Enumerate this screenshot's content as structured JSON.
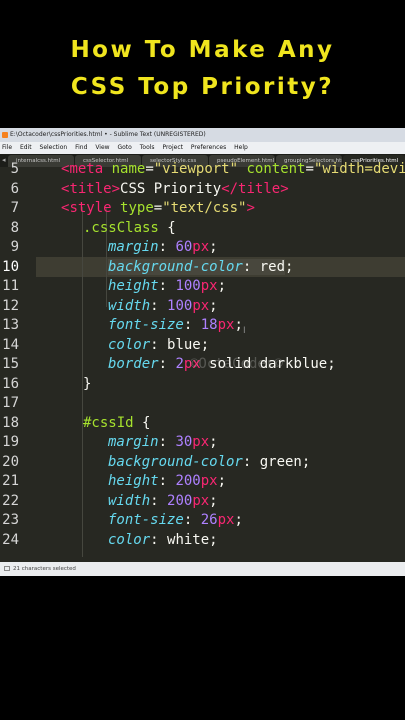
{
  "headline": {
    "line1": "How To Make Any",
    "line2": "CSS Top Priority?"
  },
  "window": {
    "title": "E:\\Octacoder\\cssPriorities.html • - Sublime Text (UNREGISTERED)",
    "menu": [
      "File",
      "Edit",
      "Selection",
      "Find",
      "View",
      "Goto",
      "Tools",
      "Project",
      "Preferences",
      "Help"
    ],
    "tabs": [
      "internalcss.html",
      "cssSelector.html",
      "selectorStyle.css",
      "pseudoElement.html",
      "groupingSelectors.html",
      "cssPriorities.html"
    ],
    "active_tab_index": 5,
    "status": "21 characters selected",
    "watermark": "©OctaCoder©",
    "current_line": "10"
  },
  "editor": {
    "line_numbers": [
      "5",
      "6",
      "7",
      "8",
      "9",
      "10",
      "11",
      "12",
      "13",
      "14",
      "15",
      "16",
      "17",
      "18",
      "19",
      "20",
      "21",
      "22",
      "23",
      "24"
    ],
    "code": {
      "l5_open": "<",
      "l5_tag": "meta",
      "l5_a1": "name",
      "l5_eq1": "=",
      "l5_v1": "\"viewport\"",
      "l5_a2": "content",
      "l5_eq2": "=",
      "l5_v2": "\"width=device-width, ini",
      "l6_open": "<",
      "l6_tag": "title",
      "l6_close": ">",
      "l6_text": "CSS Priority",
      "l6_end_open": "</",
      "l6_end_tag": "title",
      "l6_end_close": ">",
      "l7_open": "<",
      "l7_tag": "style",
      "l7_attr": "type",
      "l7_eq": "=",
      "l7_val": "\"text/css\"",
      "l7_close": ">",
      "l8_sel": ".cssClass",
      "l8_brace": " {",
      "l9_prop": "margin",
      "l9_num": "60",
      "l9_unit": "px",
      "l10_prop": "background-color",
      "l10_val": "red",
      "l11_prop": "height",
      "l11_num": "100",
      "l11_unit": "px",
      "l12_prop": "width",
      "l12_num": "100",
      "l12_unit": "px",
      "l13_prop": "font-size",
      "l13_num": "18",
      "l13_unit": "px",
      "l14_prop": "color",
      "l14_val": "blue",
      "l15_prop": "border",
      "l15_num": "2",
      "l15_unit": "px",
      "l15_val": "solid darkblue",
      "l16_brace": "}",
      "l18_sel": "#cssId",
      "l18_brace": " {",
      "l19_prop": "margin",
      "l19_num": "30",
      "l19_unit": "px",
      "l20_prop": "background-color",
      "l20_val": "green",
      "l21_prop": "height",
      "l21_num": "200",
      "l21_unit": "px",
      "l22_prop": "width",
      "l22_num": "200",
      "l22_unit": "px",
      "l23_prop": "font-size",
      "l23_num": "26",
      "l23_unit": "px",
      "l24_prop": "color",
      "l24_val": "white"
    }
  },
  "colors": {
    "headline": "#f0e51e",
    "editor_bg": "#272822",
    "tag": "#f92672",
    "attr": "#a6e22e",
    "string": "#e6db74",
    "property": "#66d9ef",
    "number": "#ae81ff"
  }
}
